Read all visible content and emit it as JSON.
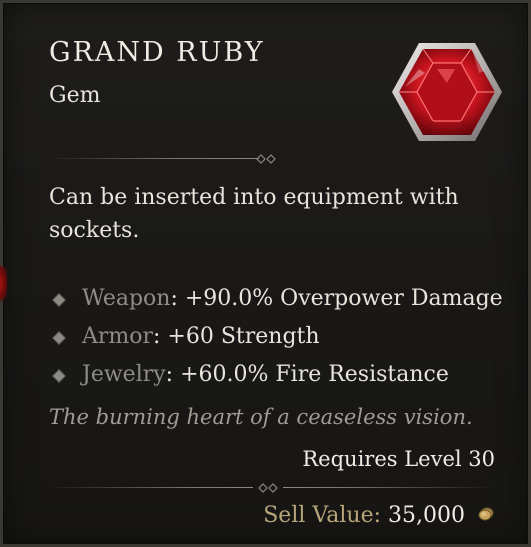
{
  "item": {
    "name": "GRAND RUBY",
    "type": "Gem",
    "icon": "red-gem-icon",
    "description": "Can be inserted into equipment with sockets.",
    "affixes": [
      {
        "slot": "Weapon",
        "effect": ": +90.0% Overpower Damage"
      },
      {
        "slot": "Armor",
        "effect": ": +60 Strength"
      },
      {
        "slot": "Jewelry",
        "effect": ": +60.0% Fire Resistance"
      }
    ],
    "flavor": "The burning heart of a ceaseless vision.",
    "requirement": "Requires Level 30",
    "sell_label": "Sell Value:",
    "sell_value": "35,000",
    "currency_icon": "gold-coin-icon"
  },
  "colors": {
    "background": "#1a1917",
    "border": "#3a3833",
    "title": "#f0ece4",
    "slot_label": "#8f8c86",
    "flavor": "#9f9c95",
    "sell_label": "#b7a57a",
    "gem": "#c01826"
  }
}
